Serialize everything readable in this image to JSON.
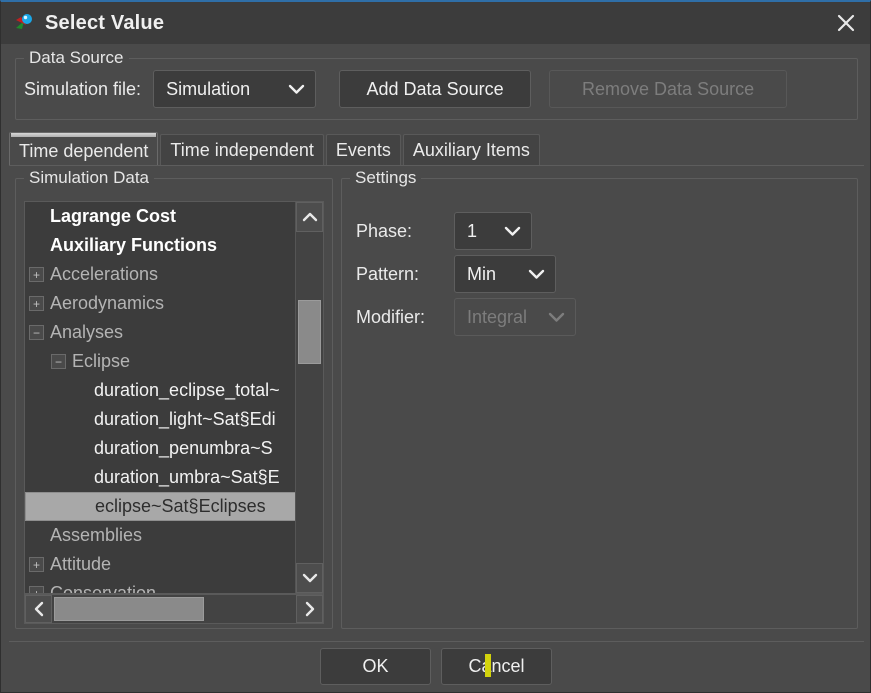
{
  "window": {
    "title": "Select Value",
    "icon": "app-logo-icon",
    "close_label": "✕",
    "accent_color": "#2f6fa8",
    "background_color": "#4a4a4a"
  },
  "data_source": {
    "group_label": "Data Source",
    "sim_file_label": "Simulation file:",
    "sim_file_value": "Simulation",
    "add_button": "Add Data Source",
    "remove_button": "Remove Data Source",
    "remove_button_enabled": false
  },
  "tabs": [
    {
      "label": "Time dependent",
      "active": true
    },
    {
      "label": "Time independent",
      "active": false
    },
    {
      "label": "Events",
      "active": false
    },
    {
      "label": "Auxiliary Items",
      "active": false
    }
  ],
  "simulation_data": {
    "group_label": "Simulation Data",
    "tree": [
      {
        "label": "Lagrange Cost",
        "indent": 0,
        "twisty": "",
        "style": "bold"
      },
      {
        "label": "Auxiliary Functions",
        "indent": 0,
        "twisty": "",
        "style": "bold"
      },
      {
        "label": "Accelerations",
        "indent": 0,
        "twisty": "+",
        "style": "node"
      },
      {
        "label": "Aerodynamics",
        "indent": 0,
        "twisty": "+",
        "style": "node"
      },
      {
        "label": "Analyses",
        "indent": 0,
        "twisty": "−",
        "style": "node"
      },
      {
        "label": "Eclipse",
        "indent": 1,
        "twisty": "−",
        "style": "node"
      },
      {
        "label": "duration_eclipse_total~",
        "indent": 2,
        "twisty": "",
        "style": "leaf"
      },
      {
        "label": "duration_light~Sat§Edi",
        "indent": 2,
        "twisty": "",
        "style": "leaf"
      },
      {
        "label": "duration_penumbra~S",
        "indent": 2,
        "twisty": "",
        "style": "leaf"
      },
      {
        "label": "duration_umbra~Sat§E",
        "indent": 2,
        "twisty": "",
        "style": "leaf"
      },
      {
        "label": "eclipse~Sat§Eclipses",
        "indent": 2,
        "twisty": "",
        "style": "selected"
      },
      {
        "label": "Assemblies",
        "indent": 0,
        "twisty": "",
        "style": "node"
      },
      {
        "label": "Attitude",
        "indent": 0,
        "twisty": "+",
        "style": "node"
      },
      {
        "label": "Conservation",
        "indent": 0,
        "twisty": "+",
        "style": "node"
      }
    ],
    "selected_item": "eclipse~Sat§Eclipses",
    "vscroll": {
      "up_glyph": "⌃",
      "down_glyph": "⌄"
    },
    "hscroll": {
      "left_glyph": "‹",
      "right_glyph": "›"
    }
  },
  "settings": {
    "group_label": "Settings",
    "phase_label": "Phase:",
    "phase_value": "1",
    "pattern_label": "Pattern:",
    "pattern_value": "Min",
    "modifier_label": "Modifier:",
    "modifier_value": "Integral",
    "modifier_enabled": false
  },
  "footer": {
    "ok_label": "OK",
    "cancel_label": "Cancel"
  }
}
